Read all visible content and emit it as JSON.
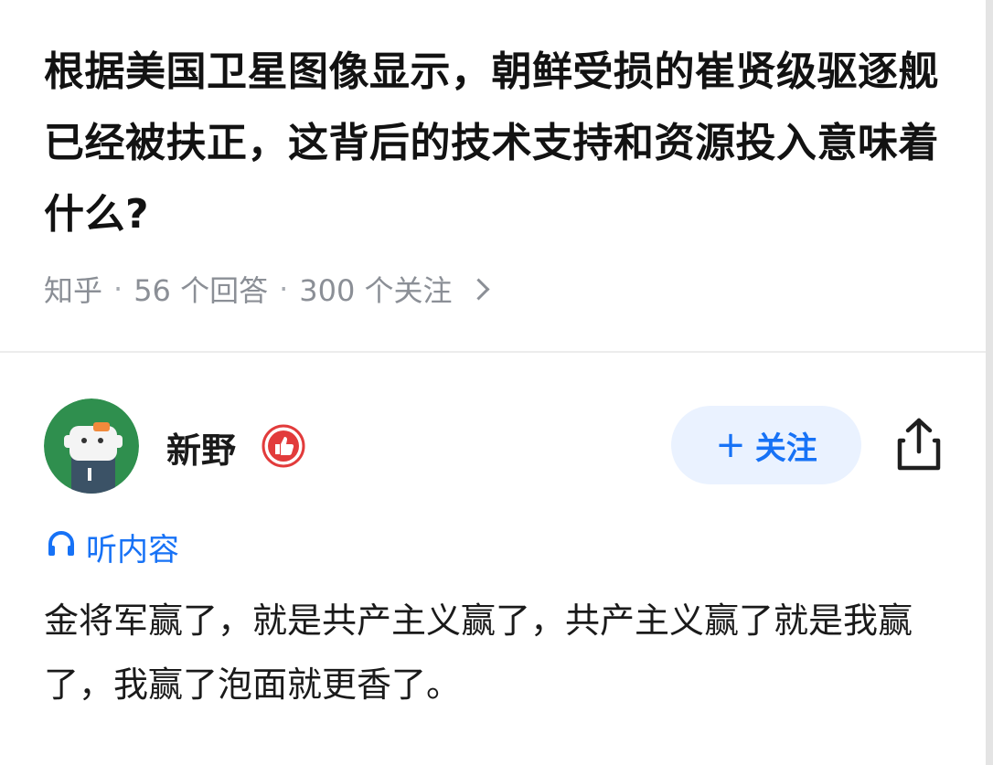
{
  "question": {
    "title": "根据美国卫星图像显示，朝鲜受损的崔贤级驱逐舰已经被扶正，这背后的技术支持和资源投入意味着什么?",
    "source": "知乎",
    "answers_count": "56 个回答",
    "followers_count": "300 个关注",
    "separator": "·"
  },
  "answer": {
    "author_name": "新野",
    "follow_label": "关注",
    "follow_plus": "+",
    "listen_label": "听内容",
    "content": "金将军赢了，就是共产主义赢了，共产主义赢了就是我赢了，我赢了泡面就更香了。"
  },
  "icons": {
    "badge": "thumbs-up-badge-icon",
    "share": "share-icon",
    "headphones": "headphones-icon",
    "chevron": "chevron-right-icon"
  },
  "colors": {
    "accent": "#1772f6",
    "follow_bg": "#eaf2ff",
    "badge_red": "#e23b3b",
    "meta_gray": "#8b8f96",
    "avatar_green": "#2f8f4e"
  }
}
